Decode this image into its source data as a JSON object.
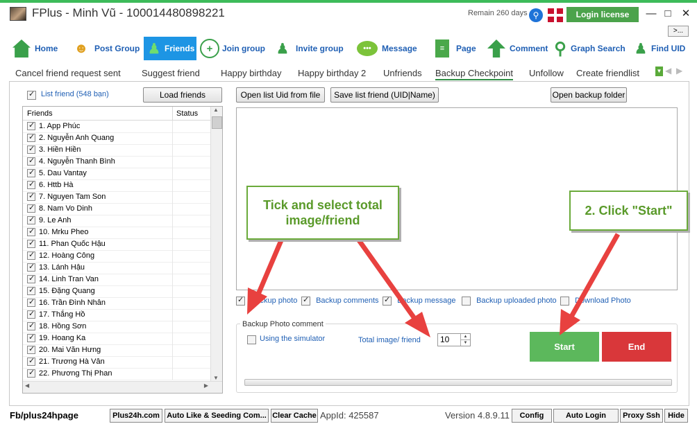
{
  "titlebar": {
    "title": "FPlus - Minh Vũ - 100014480898221",
    "remain": "Remain 260 days",
    "login_license": "Login license",
    "expand_label": ">..."
  },
  "toolbar": {
    "items": [
      {
        "label": "Home",
        "icon": "home-icon"
      },
      {
        "label": "Post Group",
        "icon": "group-icon"
      },
      {
        "label": "Friends",
        "icon": "friends-icon",
        "active": true
      },
      {
        "label": "Join group",
        "icon": "join-group-icon"
      },
      {
        "label": "Invite group",
        "icon": "invite-group-icon"
      },
      {
        "label": "Message",
        "icon": "message-icon"
      },
      {
        "label": "Page",
        "icon": "page-icon"
      },
      {
        "label": "Comment",
        "icon": "comment-arrow-icon"
      },
      {
        "label": "Graph Search",
        "icon": "search-icon"
      },
      {
        "label": "Find UID",
        "icon": "find-uid-icon"
      }
    ]
  },
  "subtabs": [
    "Cancel friend request sent",
    "Suggest friend",
    "Happy birthday",
    "Happy birthday 2",
    "Unfriends",
    "Backup Checkpoint",
    "Unfollow",
    "Create friendlist"
  ],
  "left": {
    "list_friend_label": "List friend (548 bạn)",
    "load_friends": "Load friends",
    "col_friends": "Friends",
    "col_status": "Status",
    "friends": [
      "1. App Phúc",
      "2. Nguyễn Anh Quang",
      "3. Hiền Hiền",
      "4. Nguyễn Thanh Bình",
      "5. Dau Vantay",
      "6. Httb Hà",
      "7. Nguyen Tam Son",
      "8. Nam Vo Dinh",
      "9. Le Anh",
      "10. Mrku Pheo",
      "11. Phan Quốc Hậu",
      "12. Hoàng Công",
      "13. Lánh Hậu",
      "14. Linh Tran Van",
      "15. Đặng Quang",
      "16. Trần Đình Nhân",
      "17. Thắng Hồ",
      "18. Hồng Sơn",
      "19. Hoang Ka",
      "20. Mai Văn Hưng",
      "21. Trương Hà Vân",
      "22. Phương Thị Phan"
    ]
  },
  "right": {
    "open_list": "Open list Uid from file",
    "save_list": "Save list friend (UID|Name)",
    "open_backup": "Open backup folder",
    "options": [
      {
        "label": "Backup photo",
        "checked": true
      },
      {
        "label": "Backup comments",
        "checked": true
      },
      {
        "label": "Backup message",
        "checked": true
      },
      {
        "label": "Backup uploaded photo",
        "checked": false
      },
      {
        "label": "Download Photo",
        "checked": false
      }
    ],
    "group_title": "Backup Photo  comment",
    "simulator": "Using the simulator",
    "total_label": "Total image/ friend",
    "total_value": "10",
    "start": "Start",
    "end": "End"
  },
  "callouts": {
    "tick": "Tick and select total image/friend",
    "click_start": "2. Click \"Start\""
  },
  "status": {
    "fb_page": "Fb/plus24hpage",
    "buttons": [
      "Plus24h.com",
      "Auto Like & Seeding Com...",
      "Clear Cache"
    ],
    "appid": "AppId: 425587",
    "version": "Version 4.8.9.11",
    "right_buttons": [
      "Config",
      "Auto Login",
      "Proxy Ssh",
      "Hide"
    ]
  },
  "colors": {
    "accent": "#1d95e4",
    "start": "#5cb85c",
    "end": "#d9373a",
    "arrow": "#e8413f"
  }
}
